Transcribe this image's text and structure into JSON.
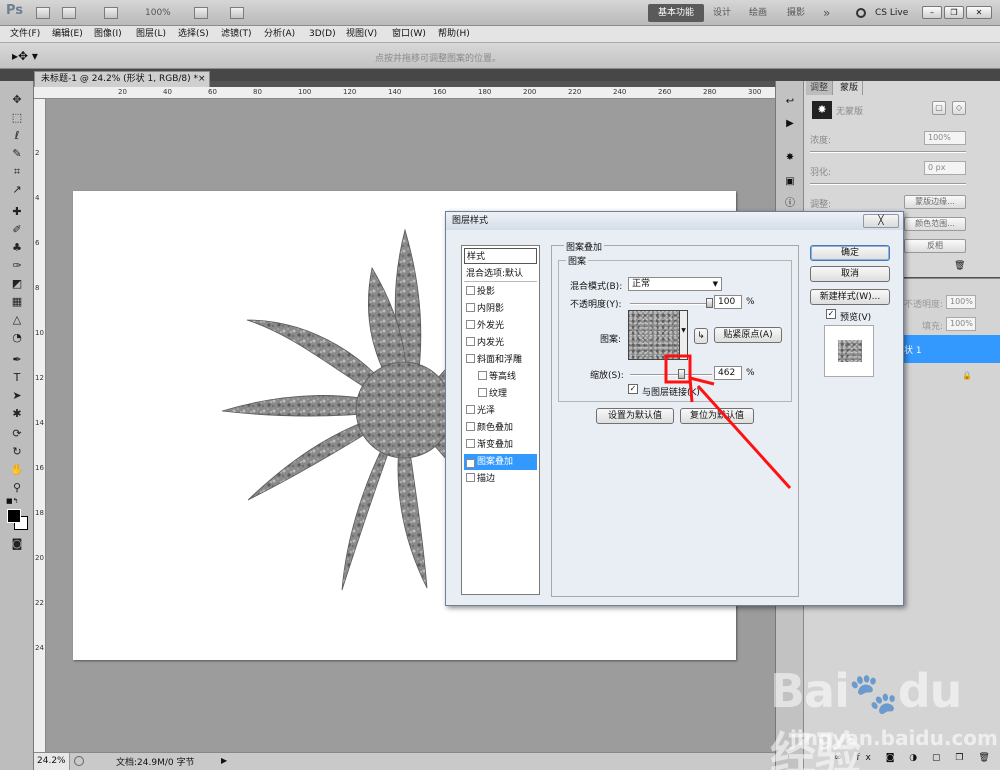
{
  "app": {
    "logo": "Ps",
    "zoom_readout": "100%",
    "workspaces": [
      "基本功能",
      "设计",
      "绘画",
      "摄影"
    ],
    "more": "»",
    "cslive": "CS Live"
  },
  "menu": [
    "文件(F)",
    "编辑(E)",
    "图像(I)",
    "图层(L)",
    "选择(S)",
    "滤镜(T)",
    "分析(A)",
    "3D(D)",
    "视图(V)",
    "窗口(W)",
    "帮助(H)"
  ],
  "options_hint": "点按并拖移可调整图案的位置。",
  "doc_tab": {
    "title": "未标题-1 @ 24.2% (形状 1, RGB/8) *",
    "close": "×"
  },
  "ruler_top": [
    "20",
    "40",
    "60",
    "80",
    "100",
    "120",
    "140",
    "160",
    "180",
    "200",
    "220",
    "240",
    "260",
    "280",
    "300"
  ],
  "ruler_left": [
    "2",
    "4",
    "6",
    "8",
    "10",
    "12",
    "14",
    "16",
    "18",
    "20",
    "22",
    "24"
  ],
  "status": {
    "zoom": "24.2%",
    "doc_info": "文档:24.9M/0 字节"
  },
  "masks_panel": {
    "tab_adjust": "调整",
    "tab_masks": "蒙版",
    "no_mask": "无蒙版",
    "density_label": "浓度:",
    "density_value": "100%",
    "feather_label": "羽化:",
    "feather_value": "0 px",
    "refine_label": "调整:",
    "mask_edge": "蒙版边缘...",
    "color_range": "颜色范围...",
    "invert": "反相"
  },
  "layers_panel": {
    "opacity_label": "不透明度:",
    "opacity_value": "100%",
    "fill_label": "填充:",
    "fill_value": "100%",
    "layer_name": "状 1"
  },
  "dialog": {
    "title": "图层样式",
    "close": "╳",
    "styles_header": "样式",
    "blend_options": "混合选项:默认",
    "effects": [
      {
        "label": "投影",
        "checked": false,
        "indent": false
      },
      {
        "label": "内阴影",
        "checked": false,
        "indent": false
      },
      {
        "label": "外发光",
        "checked": false,
        "indent": false
      },
      {
        "label": "内发光",
        "checked": false,
        "indent": false
      },
      {
        "label": "斜面和浮雕",
        "checked": false,
        "indent": false
      },
      {
        "label": "等高线",
        "checked": false,
        "indent": true
      },
      {
        "label": "纹理",
        "checked": false,
        "indent": true
      },
      {
        "label": "光泽",
        "checked": false,
        "indent": false
      },
      {
        "label": "颜色叠加",
        "checked": false,
        "indent": false
      },
      {
        "label": "渐变叠加",
        "checked": false,
        "indent": false
      },
      {
        "label": "图案叠加",
        "checked": true,
        "indent": false,
        "selected": true
      },
      {
        "label": "描边",
        "checked": false,
        "indent": false
      }
    ],
    "group_title": "图案叠加",
    "subgroup_title": "图案",
    "blend_mode_label": "混合模式(B):",
    "blend_mode_value": "正常",
    "opacity_label": "不透明度(Y):",
    "opacity_value": "100",
    "percent": "%",
    "pattern_label": "图案:",
    "snap_origin": "贴紧原点(A)",
    "scale_label": "缩放(S):",
    "scale_value": "462",
    "link_with_layer": "与图层链接(K)",
    "link_checked": true,
    "make_default": "设置为默认值",
    "reset_default": "复位为默认值",
    "ok": "确定",
    "cancel": "取消",
    "new_style": "新建样式(W)...",
    "preview_label": "预览(V)",
    "preview_checked": true
  },
  "watermark": {
    "logo": "Bai du 经验",
    "url": "jingyan.baidu.com"
  },
  "colors": {
    "accent_selection": "#3399ff",
    "annotation_red": "#ff1111",
    "canvas_bg": "#9c9c9c"
  }
}
